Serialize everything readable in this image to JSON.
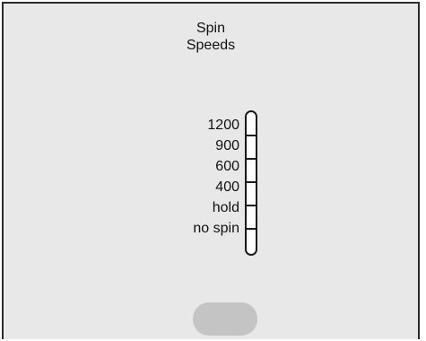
{
  "title": {
    "line1": "Spin",
    "line2": "Speeds"
  },
  "speeds": [
    "1200",
    "900",
    "600",
    "400",
    "hold",
    "no spin"
  ],
  "colors": {
    "background": "#e8e8e8",
    "border": "#2c2c2c",
    "scale_fill": "#ffffff",
    "button": "#c4c4c4"
  }
}
